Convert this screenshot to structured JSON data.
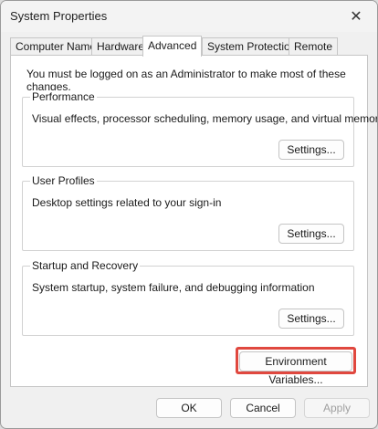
{
  "window": {
    "title": "System Properties",
    "close_glyph": "✕"
  },
  "tabs": [
    {
      "label": "Computer Name"
    },
    {
      "label": "Hardware"
    },
    {
      "label": "Advanced",
      "active": true
    },
    {
      "label": "System Protection"
    },
    {
      "label": "Remote"
    }
  ],
  "admin_note": "You must be logged on as an Administrator to make most of these changes.",
  "groups": {
    "performance": {
      "label": "Performance",
      "description": "Visual effects, processor scheduling, memory usage, and virtual memory",
      "button": "Settings..."
    },
    "user_profiles": {
      "label": "User Profiles",
      "description": "Desktop settings related to your sign-in",
      "button": "Settings..."
    },
    "startup_recovery": {
      "label": "Startup and Recovery",
      "description": "System startup, system failure, and debugging information",
      "button": "Settings..."
    }
  },
  "env_button": "Environment Variables...",
  "footer": {
    "ok": "OK",
    "cancel": "Cancel",
    "apply": "Apply"
  },
  "colors": {
    "highlight": "#e0483f"
  }
}
